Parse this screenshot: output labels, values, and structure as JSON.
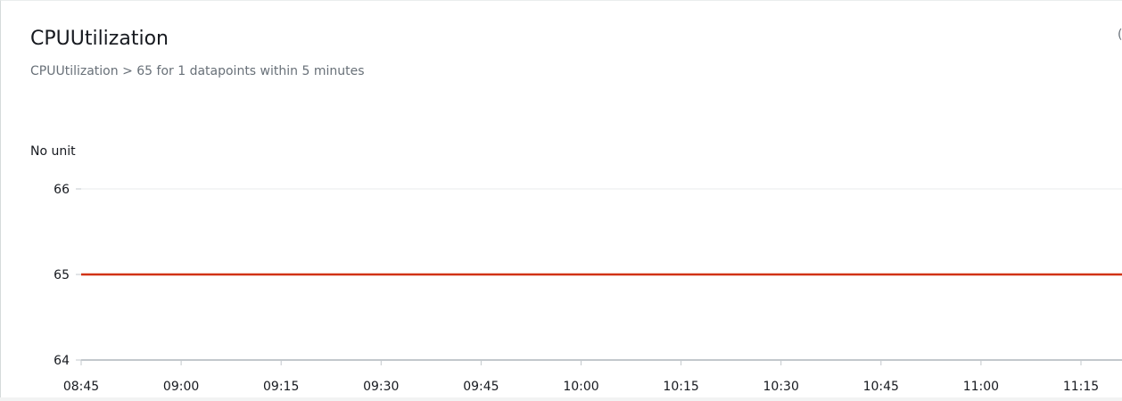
{
  "widget": {
    "title": "CPUUtilization",
    "subtitle": "CPUUtilization > 65 for 1 datapoints within 5 minutes",
    "unit_label": "No unit",
    "corner_glyph": "("
  },
  "colors": {
    "threshold_line": "#d13212",
    "grid": "#e9ebed",
    "axis": "#c3c8cc",
    "tick_text": "#16191f"
  },
  "chart_data": {
    "type": "line",
    "title": "CPUUtilization",
    "ylabel": "No unit",
    "xlabel": "",
    "ylim": [
      64,
      66
    ],
    "y_ticks": [
      "66",
      "65",
      "64"
    ],
    "x_ticks": [
      "08:45",
      "09:00",
      "09:15",
      "09:30",
      "09:45",
      "10:00",
      "10:15",
      "10:30",
      "10:45",
      "11:00",
      "11:15"
    ],
    "series": [
      {
        "type": "threshold",
        "x": [
          "08:45",
          "11:15"
        ],
        "values": [
          65,
          65
        ]
      }
    ],
    "grid": true
  }
}
